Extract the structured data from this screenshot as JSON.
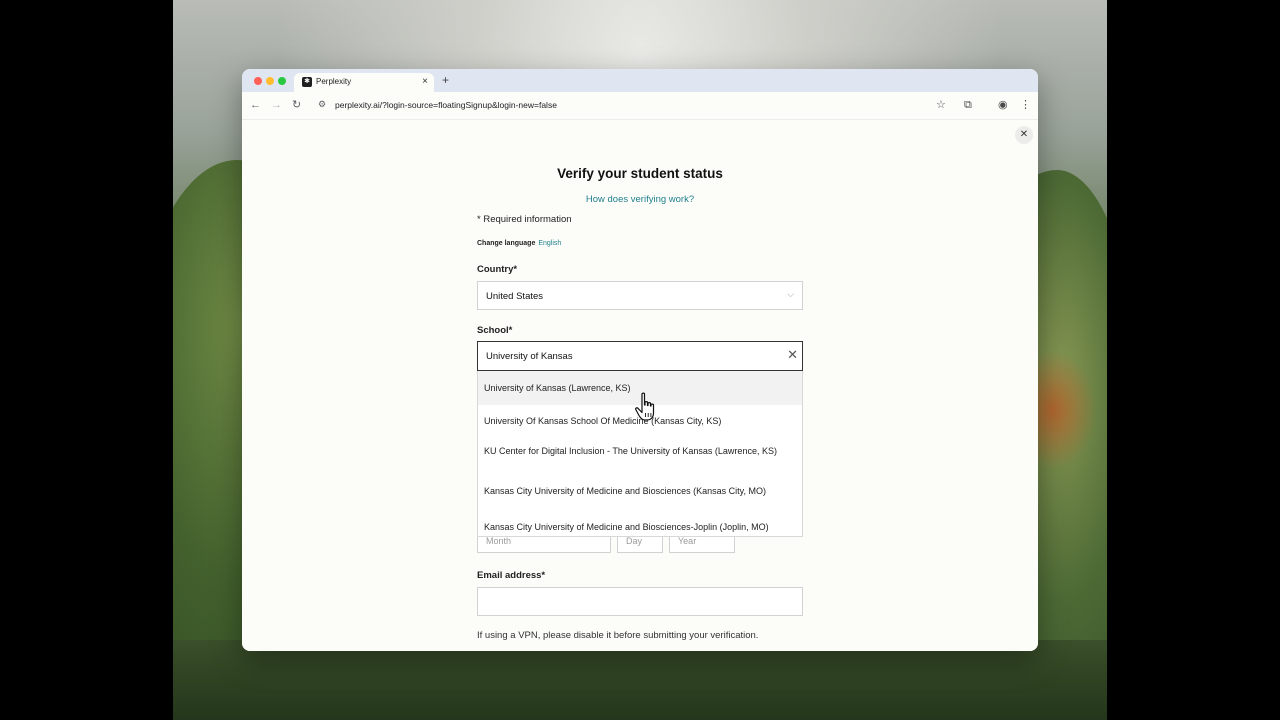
{
  "browser": {
    "tab_title": "Perplexity",
    "tab_favicon": "perplexity-logo",
    "new_tab": "+",
    "tab_close": "×",
    "url": "perplexity.ai/?login-source=floatingSignup&login-new=false"
  },
  "icons": {
    "back": "←",
    "forward": "→",
    "reload": "↻",
    "site_info": "⚙",
    "star": "☆",
    "extension": "⧉",
    "profile": "◉",
    "menu": "⋮",
    "close": "✕",
    "chevron": "⌵",
    "clear": "✕"
  },
  "form": {
    "title": "Verify your student status",
    "how_link": "How does verifying work?",
    "required_note": "* Required information",
    "change_language_label": "Change language",
    "language_value": "English",
    "country_label": "Country*",
    "country_value": "United States",
    "school_label": "School*",
    "school_value": "University of Kansas",
    "school_options": [
      "University of Kansas (Lawrence, KS)",
      "University Of Kansas School Of Medicine (Kansas City, KS)",
      "KU Center for Digital Inclusion - The University of Kansas (Lawrence, KS)",
      "Kansas City University of Medicine and Biosciences (Kansas City, MO)",
      "Kansas City University of Medicine and Biosciences-Joplin (Joplin, MO)"
    ],
    "dob_month": "Month",
    "dob_day": "Day",
    "dob_year": "Year",
    "email_label": "Email address*",
    "email_value": "",
    "vpn_note": "If using a VPN, please disable it before submitting your verification."
  }
}
